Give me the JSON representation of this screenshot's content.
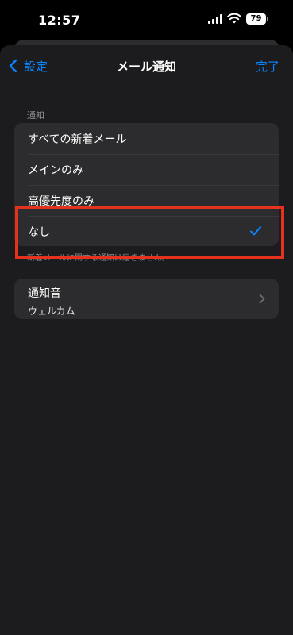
{
  "status": {
    "time": "12:57",
    "battery": "79"
  },
  "nav": {
    "back_label": "設定",
    "title": "メール通知",
    "done_label": "完了"
  },
  "notify": {
    "header": "通知",
    "options": [
      {
        "label": "すべての新着メール",
        "selected": false
      },
      {
        "label": "メインのみ",
        "selected": false
      },
      {
        "label": "高優先度のみ",
        "selected": false
      },
      {
        "label": "なし",
        "selected": true
      }
    ],
    "footnote": "新着メールに関する通知は届きません。"
  },
  "sound": {
    "title": "通知音",
    "value": "ウェルカム"
  },
  "colors": {
    "accent": "#0a84ff",
    "highlight": "#e5321f"
  },
  "icons": {
    "back": "chevron-left-icon",
    "check": "checkmark-icon",
    "disclosure": "chevron-right-icon"
  }
}
